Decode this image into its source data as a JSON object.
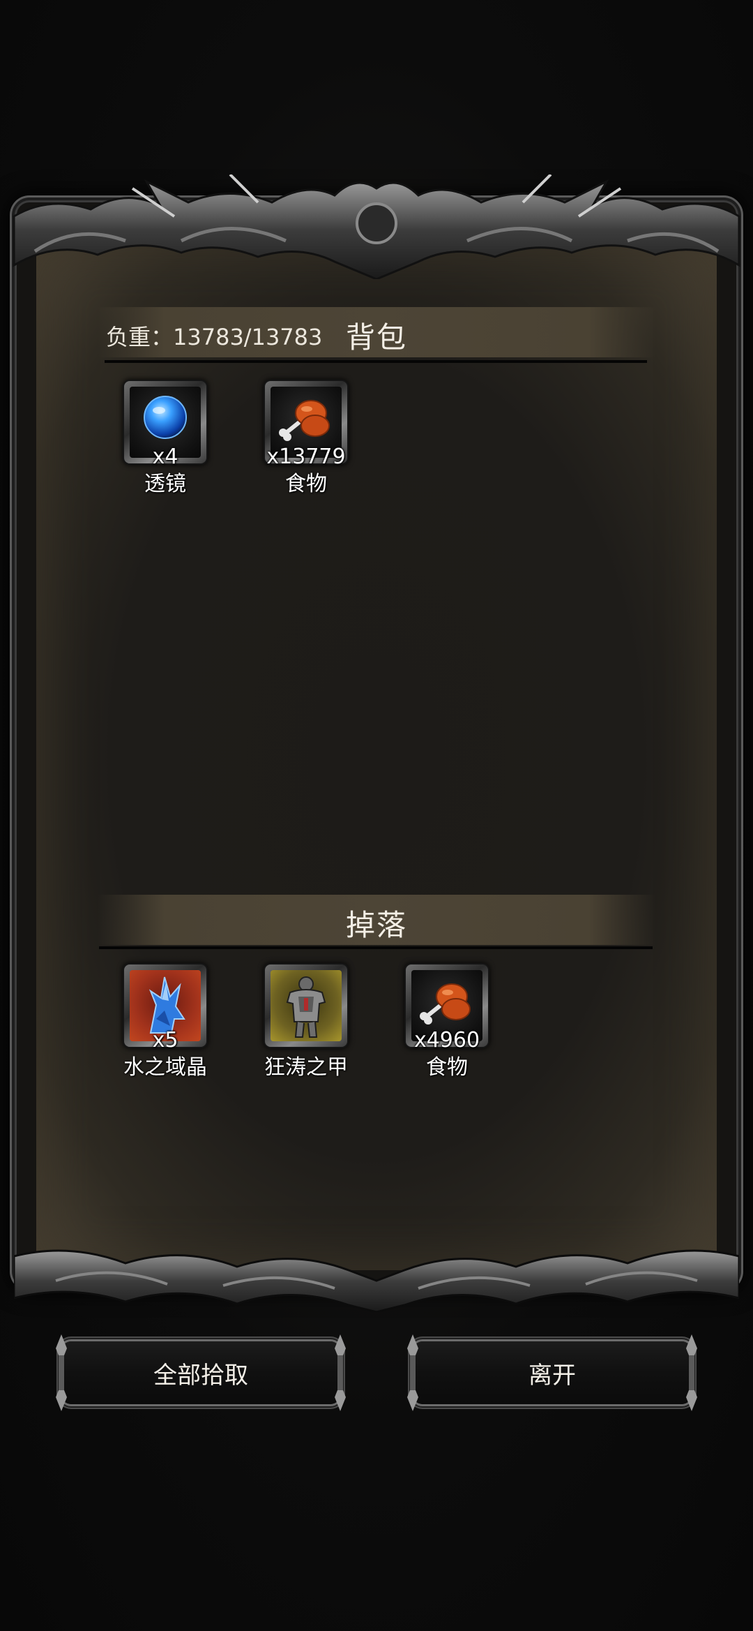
{
  "inventory": {
    "weight_label": "负重：13783/13783",
    "title": "背包",
    "items": [
      {
        "name": "透镜",
        "count": "x4",
        "icon": "blue-orb-icon"
      },
      {
        "name": "食物",
        "count": "x13779",
        "icon": "meat-drumstick-icon"
      }
    ]
  },
  "drops": {
    "title": "掉落",
    "items": [
      {
        "name": "水之域晶",
        "count": "x5",
        "icon": "water-crystal-icon",
        "rarity_color": "#c2461f"
      },
      {
        "name": "狂涛之甲",
        "count": "",
        "icon": "armor-icon",
        "rarity_color": "#a8962c"
      },
      {
        "name": "食物",
        "count": "x4960",
        "icon": "meat-drumstick-icon"
      }
    ]
  },
  "buttons": {
    "pickup_all": "全部拾取",
    "leave": "离开"
  }
}
